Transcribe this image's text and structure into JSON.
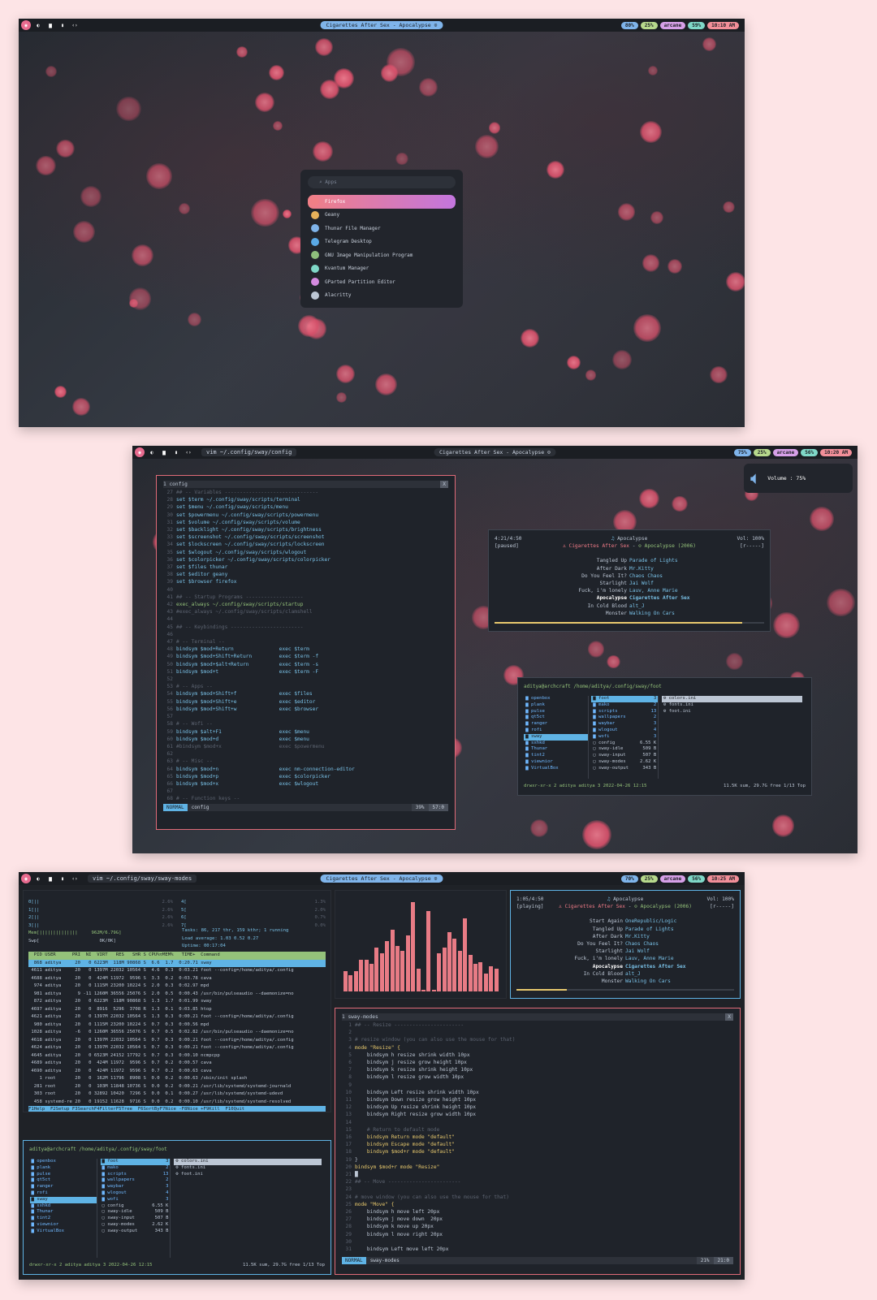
{
  "now_playing": "Cigarettes After Sex - Apocalypse",
  "screen1": {
    "status": [
      {
        "t": "80%",
        "c": "#7fb4ea"
      },
      {
        "t": "25%",
        "c": "#b7d98c"
      },
      {
        "t": "arcane",
        "c": "#d7a0e8"
      },
      {
        "t": "59%",
        "c": "#7fd8c8"
      },
      {
        "t": "10:10 AM",
        "c": "#f28f99"
      }
    ],
    "launcher": {
      "placeholder": "Apps",
      "apps": [
        "Firefox",
        "Geany",
        "Thunar File Manager",
        "Telegram Desktop",
        "GNU Image Manipulation Program",
        "Kvantum Manager",
        "GParted Partition Editor",
        "Alacritty"
      ]
    }
  },
  "screen2": {
    "window_title": "vim ~/.config/sway/config",
    "status": [
      {
        "t": "75%",
        "c": "#7fb4ea"
      },
      {
        "t": "25%",
        "c": "#b7d98c"
      },
      {
        "t": "arcane",
        "c": "#d7a0e8"
      },
      {
        "t": "56%",
        "c": "#7fd8c8"
      },
      {
        "t": "10:20 AM",
        "c": "#f28f99"
      }
    ],
    "volume": "Volume : 75%",
    "vim": {
      "tab": "1 config",
      "close": "X",
      "mode": "NORMAL",
      "file": "config",
      "pct": "39%",
      "pos": "57:0",
      "lines": [
        [
          "27",
          "## -- Variables -------------------------------",
          "c"
        ],
        [
          "28",
          "set $term ~/.config/sway/scripts/terminal",
          "set"
        ],
        [
          "29",
          "set $menu ~/.config/sway/scripts/menu",
          "set"
        ],
        [
          "30",
          "set $powermenu ~/.config/sway/scripts/powermenu",
          "set"
        ],
        [
          "31",
          "set $volume ~/.config/sway/scripts/volume",
          "set"
        ],
        [
          "32",
          "set $backlight ~/.config/sway/scripts/brightness",
          "set"
        ],
        [
          "33",
          "set $screenshot ~/.config/sway/scripts/screenshot",
          "set"
        ],
        [
          "34",
          "set $lockscreen ~/.config/sway/scripts/lockscreen",
          "set"
        ],
        [
          "35",
          "set $wlogout ~/.config/sway/scripts/wlogout",
          "set"
        ],
        [
          "36",
          "set $colorpicker ~/.config/sway/scripts/colorpicker",
          "set"
        ],
        [
          "37",
          "set $files thunar",
          "set"
        ],
        [
          "38",
          "set $editor geany",
          "set"
        ],
        [
          "39",
          "set $browser firefox",
          "set"
        ],
        [
          "40",
          "",
          ""
        ],
        [
          "41",
          "## -- Startup Programs -------------------",
          "c"
        ],
        [
          "42",
          "exec_always ~/.config/sway/scripts/startup",
          "x"
        ],
        [
          "43",
          "#exec_always ~/.config/sway/scripts/clamshell",
          "c"
        ],
        [
          "44",
          "",
          ""
        ],
        [
          "45",
          "## -- Keybindings ------------------------",
          "c"
        ],
        [
          "46",
          "",
          ""
        ],
        [
          "47",
          "# -- Terminal --",
          "c"
        ],
        [
          "48",
          "bindsym $mod+Return               exec $term",
          "b"
        ],
        [
          "49",
          "bindsym $mod+Shift+Return         exec $term -f",
          "b"
        ],
        [
          "50",
          "bindsym $mod+$alt+Return          exec $term -s",
          "b"
        ],
        [
          "51",
          "bindsym $mod+t                    exec $term -F",
          "b"
        ],
        [
          "52",
          "",
          ""
        ],
        [
          "53",
          "# -- Apps --",
          "c"
        ],
        [
          "54",
          "bindsym $mod+Shift+f              exec $files",
          "b"
        ],
        [
          "55",
          "bindsym $mod+Shift+e              exec $editor",
          "b"
        ],
        [
          "56",
          "bindsym $mod+Shift+w              exec $browser",
          "b"
        ],
        [
          "57",
          "",
          ""
        ],
        [
          "58",
          "# -- Wofi --",
          "c"
        ],
        [
          "59",
          "bindsym $alt+F1                   exec $menu",
          "b"
        ],
        [
          "60",
          "bindsym $mod+d                    exec $menu",
          "b"
        ],
        [
          "61",
          "#bindsym $mod+x                   exec $powermenu",
          "c"
        ],
        [
          "62",
          "",
          ""
        ],
        [
          "63",
          "# -- Misc --",
          "c"
        ],
        [
          "64",
          "bindsym $mod+n                    exec nm-connection-editor",
          "b"
        ],
        [
          "65",
          "bindsym $mod+p                    exec $colorpicker",
          "b"
        ],
        [
          "66",
          "bindsym $mod+x                    exec $wlogout",
          "b"
        ],
        [
          "67",
          "",
          ""
        ],
        [
          "68",
          "# -- Function keys --",
          "c"
        ]
      ]
    },
    "ncmpcpp": {
      "time": "4:21/4:50",
      "state": "[paused]",
      "album": "Apocalypse",
      "artist": "Cigarettes After Sex",
      "album_year": "Apocalypse (2006)",
      "vol": "Vol: 100%",
      "flags": "[r-----]",
      "progress": 0.92,
      "tracks": [
        [
          "Tangled Up",
          "Parade of Lights"
        ],
        [
          "After Dark",
          "Mr.Kitty"
        ],
        [
          "Do You Feel It?",
          "Chaos Chaos"
        ],
        [
          "Starlight",
          "Jai Wolf"
        ],
        [
          "Fuck, i'm lonely",
          "Lauv, Anne Marie"
        ],
        [
          "Apocalypse",
          "Cigarettes After Sex"
        ],
        [
          "In Cold Blood",
          "alt_J"
        ],
        [
          "Monster",
          "Walking On Cars"
        ]
      ]
    },
    "fm": {
      "header": "aditya@archcraft /home/aditya/.config/sway/foot",
      "col1": [
        "openbox",
        "plank",
        "pulse",
        "qt5ct",
        "ranger",
        "rofi",
        "sway",
        "sxhkd",
        "Thunar",
        "tint2",
        "viewnior",
        "VirtualBox"
      ],
      "col2": [
        [
          "foot",
          "3"
        ],
        [
          "mako",
          "2"
        ],
        [
          "scripts",
          "13"
        ],
        [
          "wallpapers",
          "2"
        ],
        [
          "waybar",
          "3"
        ],
        [
          "wlogout",
          "4"
        ],
        [
          "wofi",
          "3"
        ],
        [
          "config",
          "6.55 K"
        ],
        [
          "sway-idle",
          "509 B"
        ],
        [
          "sway-input",
          "507 B"
        ],
        [
          "sway-modes",
          "2.62 K"
        ],
        [
          "sway-output",
          "343 B"
        ]
      ],
      "col3": [
        "colors.ini",
        "fonts.ini",
        "foot.ini"
      ],
      "footer_left": "drwxr-xr-x 2 aditya aditya 3 2022-04-26 12:15",
      "footer_right": "11.5K sum, 29.7G free  1/13  Top"
    }
  },
  "screen3": {
    "window_title": "vim ~/.config/sway/sway-modes",
    "status": [
      {
        "t": "70%",
        "c": "#7fb4ea"
      },
      {
        "t": "25%",
        "c": "#b7d98c"
      },
      {
        "t": "arcane",
        "c": "#d7a0e8"
      },
      {
        "t": "56%",
        "c": "#7fd8c8"
      },
      {
        "t": "10:25 AM",
        "c": "#f28f99"
      }
    ],
    "htop": {
      "cpus": [
        "0[||",
        "1[||",
        "2[||",
        "3[||",
        "4[",
        "5[",
        "6[",
        "7["
      ],
      "cpu_pct": [
        "2.6%",
        "2.6%",
        "2.6%",
        "2.6%",
        "1.3%",
        "2.0%",
        "0.7%",
        "0.0%"
      ],
      "mem": "Mem[||||||||||||||     962M/6.79G]",
      "swp": "Swp[                      0K/0K]",
      "tasks": "Tasks: 86, 217 thr, 159 kthr; 1 running",
      "load": "Load average: 1.03 0.52 0.27",
      "uptime": "Uptime: 00:17:04",
      "header": "  PID USER      PRI  NI  VIRT   RES   SHR S CPU%▽MEM%   TIME+  Command",
      "rows": [
        "  868 aditya     20   0 6223M  118M 90868 S  6.6  1.7  0:20.71 sway",
        " 4611 aditya     20   0 1397M 22032 10564 S  4.6  0.3  0:03.21 foot --config=/home/aditya/.config",
        " 4688 aditya     20   0  424M 11972  9596 S  3.3  0.2  0:03.78 cava",
        "  974 aditya     20   0 1115M 23200 10224 S  2.0  0.3  0:02.97 mpd",
        "  981 aditya      9 -11 1260M 36556 25076 S  2.0  0.5  0:00.43 /usr/bin/pulseaudio --daemonize=no",
        "  872 aditya     20   0 6223M  118M 90868 S  1.3  1.7  0:01.99 sway",
        " 4697 aditya     20   0  8916  5296  3708 R  1.3  0.1  0:03.85 htop",
        " 4621 aditya     20   0 1397M 22032 10564 S  1.3  0.3  0:00.21 foot --config=/home/aditya/.config",
        "  980 aditya     20   0 1115M 23200 10224 S  0.7  0.3  0:00.56 mpd",
        " 1028 aditya     -6   0 1260M 36556 25076 S  0.7  0.5  0:02.82 /usr/bin/pulseaudio --daemonize=no",
        " 4618 aditya     20   0 1397M 22032 10564 S  0.7  0.3  0:00.21 foot --config=/home/aditya/.config",
        " 4624 aditya     20   0 1397M 22032 10564 S  0.7  0.3  0:00.21 foot --config=/home/aditya/.config",
        " 4645 aditya     20   0 6523M 24152 17792 S  0.7  0.3  0:00.10 ncmpcpp",
        " 4689 aditya     20   0  424M 11972  9596 S  0.7  0.2  0:00.57 cava",
        " 4690 aditya     20   0  424M 11972  9596 S  0.7  0.2  0:00.63 cava",
        "    1 root       20   0  162M 11796  8908 S  0.0  0.2  0:00.63 /sbin/init splash",
        "  281 root       20   0  103M 11848 10736 S  0.0  0.2  0:00.21 /usr/lib/systemd/systemd-journald",
        "  303 root       20   0 32892 10420  7296 S  0.0  0.1  0:00.27 /usr/lib/systemd/systemd-udevd",
        "  458 systemd-re 20   0 19152 11628  9716 S  0.0  0.2  0:00.10 /usr/lib/systemd/systemd-resolved"
      ],
      "footer": "F1Help  F2Setup F3SearchF4FilterF5Tree  F6SortByF7Nice -F8Nice +F9Kill  F10Quit"
    },
    "cava": [
      0.22,
      0.18,
      0.22,
      0.35,
      0.35,
      0.3,
      0.48,
      0.42,
      0.55,
      0.68,
      0.5,
      0.45,
      0.62,
      0.98,
      0.25,
      0.02,
      0.88,
      0.02,
      0.42,
      0.48,
      0.65,
      0.58,
      0.45,
      0.8,
      0.4,
      0.3,
      0.32,
      0.2,
      0.28,
      0.25
    ],
    "ncmpcpp": {
      "time": "1:05/4:50",
      "state": "[playing]",
      "album": "Apocalypse",
      "artist": "Cigarettes After Sex",
      "album_year": "Apocalypse (2006)",
      "vol": "Vol: 100%",
      "flags": "[r-----]",
      "progress": 0.23,
      "tracks": [
        [
          "Start Again",
          "OneRepublic/Logic"
        ],
        [
          "Tangled Up",
          "Parade of Lights"
        ],
        [
          "After Dark",
          "Mr.Kitty"
        ],
        [
          "Do You Feel It?",
          "Chaos Chaos"
        ],
        [
          "Starlight",
          "Jai Wolf"
        ],
        [
          "Fuck, i'm lonely",
          "Lauv, Anne Marie"
        ],
        [
          "Apocalypse",
          "Cigarettes After Sex"
        ],
        [
          "In Cold Blood",
          "alt_J"
        ],
        [
          "Monster",
          "Walking On Cars"
        ]
      ]
    },
    "vim": {
      "tab": "1 sway-modes",
      "close": "X",
      "mode": "NORMAL",
      "file": "sway-modes",
      "pct": "21%",
      "pos": "21:0",
      "lines": [
        [
          "1",
          "## -- Resize -----------------------",
          "c"
        ],
        [
          "2",
          "",
          ""
        ],
        [
          "3",
          "# resize window (you can also use the mouse for that)",
          "c"
        ],
        [
          "4",
          "mode \"Resize\" {",
          "m"
        ],
        [
          "5",
          "    bindsym h resize shrink width 10px",
          ""
        ],
        [
          "6",
          "    bindsym j resize grow height 10px",
          ""
        ],
        [
          "7",
          "    bindsym k resize shrink height 10px",
          ""
        ],
        [
          "8",
          "    bindsym l resize grow width 10px",
          ""
        ],
        [
          "9",
          "",
          ""
        ],
        [
          "10",
          "    bindsym Left resize shrink width 10px",
          ""
        ],
        [
          "11",
          "    bindsym Down resize grow height 10px",
          ""
        ],
        [
          "12",
          "    bindsym Up resize shrink height 10px",
          ""
        ],
        [
          "13",
          "    bindsym Right resize grow width 10px",
          ""
        ],
        [
          "14",
          "",
          ""
        ],
        [
          "15",
          "    # Return to default mode",
          "c"
        ],
        [
          "16",
          "    bindsym Return mode \"default\"",
          "m"
        ],
        [
          "17",
          "    bindsym Escape mode \"default\"",
          "m"
        ],
        [
          "18",
          "    bindsym $mod+r mode \"default\"",
          "m"
        ],
        [
          "19",
          "}",
          ""
        ],
        [
          "20",
          "bindsym $mod+r mode \"Resize\"",
          "m"
        ],
        [
          "21",
          "█",
          ""
        ],
        [
          "22",
          "## -- Move ------------------------",
          "c"
        ],
        [
          "23",
          "",
          ""
        ],
        [
          "24",
          "# move window (you can also use the mouse for that)",
          "c"
        ],
        [
          "25",
          "mode \"Move\" {",
          "m"
        ],
        [
          "26",
          "    bindsym h move left 20px",
          ""
        ],
        [
          "27",
          "    bindsym j move down  20px",
          ""
        ],
        [
          "28",
          "    bindsym k move up 20px",
          ""
        ],
        [
          "29",
          "    bindsym l move right 20px",
          ""
        ],
        [
          "30",
          "",
          ""
        ],
        [
          "31",
          "    bindsym Left move left 20px",
          ""
        ]
      ]
    }
  }
}
